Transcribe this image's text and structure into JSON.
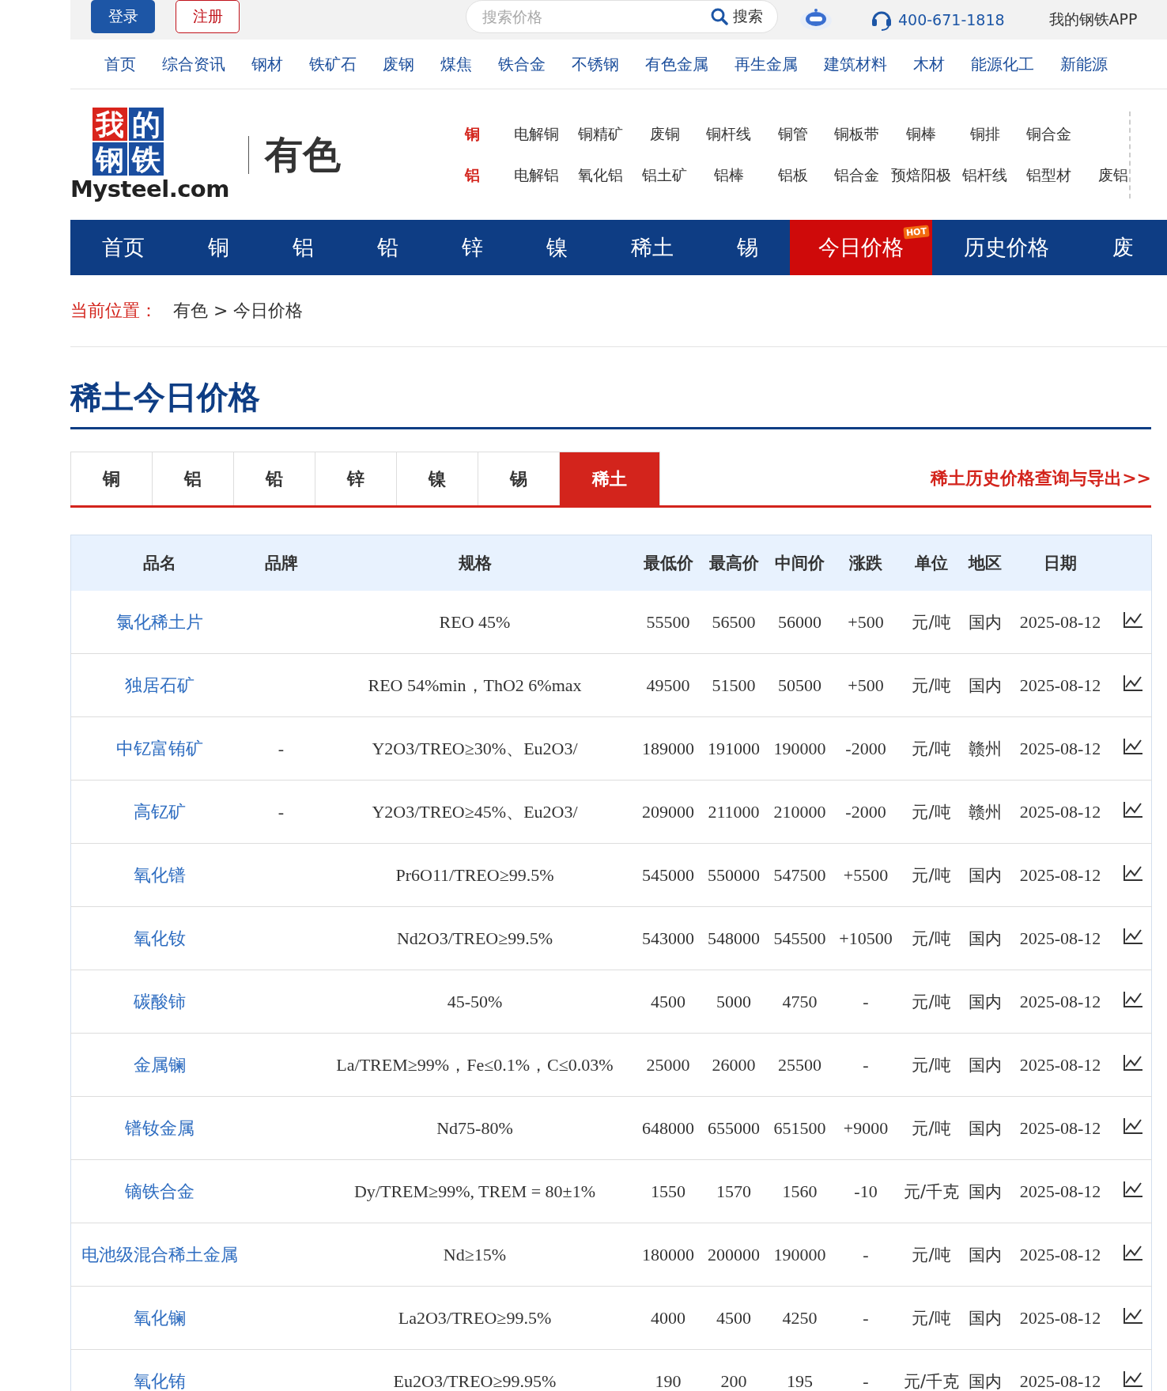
{
  "top_bar": {
    "login": "登录",
    "register": "注册",
    "search": {
      "placeholder": "搜索价格",
      "button": "搜索"
    },
    "phone": "400-671-1818",
    "app_link": "我的钢铁APP"
  },
  "main_nav": [
    "首页",
    "综合资讯",
    "钢材",
    "铁矿石",
    "废钢",
    "煤焦",
    "铁合金",
    "不锈钢",
    "有色金属",
    "再生金属",
    "建筑材料",
    "木材",
    "能源化工",
    "新能源"
  ],
  "logo": {
    "chars": "我的钢铁",
    "wordmark": "Mysteel.com"
  },
  "channel": "有色",
  "sub_links": [
    {
      "category": "铜",
      "items": [
        "电解铜",
        "铜精矿",
        "废铜",
        "铜杆线",
        "铜管",
        "铜板带",
        "铜棒",
        "铜排",
        "铜合金"
      ]
    },
    {
      "category": "铝",
      "items": [
        "电解铝",
        "氧化铝",
        "铝土矿",
        "铝棒",
        "铝板",
        "铝合金",
        "预焙阳极",
        "铝杆线",
        "铝型材",
        "废铝"
      ]
    }
  ],
  "section_nav": [
    {
      "label": "首页",
      "selected": false
    },
    {
      "label": "铜",
      "selected": false
    },
    {
      "label": "铝",
      "selected": false
    },
    {
      "label": "铅",
      "selected": false
    },
    {
      "label": "锌",
      "selected": false
    },
    {
      "label": "镍",
      "selected": false
    },
    {
      "label": "稀土",
      "selected": false
    },
    {
      "label": "锡",
      "selected": false
    },
    {
      "label": "今日价格",
      "selected": true,
      "badge": "HOT"
    },
    {
      "label": "历史价格",
      "selected": false
    },
    {
      "label": "废",
      "selected": false
    }
  ],
  "breadcrumb": {
    "label": "当前位置：",
    "path": "有色 > 今日价格"
  },
  "title": "稀土今日价格",
  "tabs": [
    {
      "label": "铜",
      "selected": false
    },
    {
      "label": "铝",
      "selected": false
    },
    {
      "label": "铅",
      "selected": false
    },
    {
      "label": "锌",
      "selected": false
    },
    {
      "label": "镍",
      "selected": false
    },
    {
      "label": "锡",
      "selected": false
    },
    {
      "label": "稀土",
      "selected": true
    }
  ],
  "history_link": "稀土历史价格查询与导出>>",
  "table": {
    "columns": [
      "品名",
      "品牌",
      "规格",
      "最低价",
      "最高价",
      "中间价",
      "涨跌",
      "单位",
      "地区",
      "日期"
    ],
    "rows": [
      {
        "name": "氯化稀土片",
        "spec": "REO 45%",
        "low": "55500",
        "high": "56500",
        "mid": "56000",
        "change": "+500",
        "unit": "元/吨",
        "region": "国内",
        "date": "2025-08-12"
      },
      {
        "name": "独居石矿",
        "spec": "REO 54%min，ThO2 6%max",
        "low": "49500",
        "high": "51500",
        "mid": "50500",
        "change": "+500",
        "unit": "元/吨",
        "region": "国内",
        "date": "2025-08-12"
      },
      {
        "name": "中钇富铕矿",
        "brand": "-",
        "spec": "Y2O3/TREO≥30%、Eu2O3/",
        "low": "189000",
        "high": "191000",
        "mid": "190000",
        "change": "-2000",
        "unit": "元/吨",
        "region": "赣州",
        "date": "2025-08-12"
      },
      {
        "name": "高钇矿",
        "brand": "-",
        "spec": "Y2O3/TREO≥45%、Eu2O3/",
        "low": "209000",
        "high": "211000",
        "mid": "210000",
        "change": "-2000",
        "unit": "元/吨",
        "region": "赣州",
        "date": "2025-08-12"
      },
      {
        "name": "氧化镨",
        "spec": "Pr6O11/TREO≥99.5%",
        "low": "545000",
        "high": "550000",
        "mid": "547500",
        "change": "+5500",
        "unit": "元/吨",
        "region": "国内",
        "date": "2025-08-12"
      },
      {
        "name": "氧化钕",
        "spec": "Nd2O3/TREO≥99.5%",
        "low": "543000",
        "high": "548000",
        "mid": "545500",
        "change": "+10500",
        "unit": "元/吨",
        "region": "国内",
        "date": "2025-08-12"
      },
      {
        "name": "碳酸铈",
        "spec": "45-50%",
        "low": "4500",
        "high": "5000",
        "mid": "4750",
        "change": "-",
        "unit": "元/吨",
        "region": "国内",
        "date": "2025-08-12"
      },
      {
        "name": "金属镧",
        "spec": "La/TREM≥99%，Fe≤0.1%，C≤0.03%",
        "low": "25000",
        "high": "26000",
        "mid": "25500",
        "change": "-",
        "unit": "元/吨",
        "region": "国内",
        "date": "2025-08-12"
      },
      {
        "name": "镨钕金属",
        "spec": "Nd75-80%",
        "low": "648000",
        "high": "655000",
        "mid": "651500",
        "change": "+9000",
        "unit": "元/吨",
        "region": "国内",
        "date": "2025-08-12"
      },
      {
        "name": "镝铁合金",
        "spec": "Dy/TREM≥99%, TREM = 80±1%",
        "low": "1550",
        "high": "1570",
        "mid": "1560",
        "change": "-10",
        "unit": "元/千克",
        "region": "国内",
        "date": "2025-08-12"
      },
      {
        "name": "电池级混合稀土金属",
        "spec": "Nd≥15%",
        "low": "180000",
        "high": "200000",
        "mid": "190000",
        "change": "-",
        "unit": "元/吨",
        "region": "国内",
        "date": "2025-08-12"
      },
      {
        "name": "氧化镧",
        "spec": "La2O3/TREO≥99.5%",
        "low": "4000",
        "high": "4500",
        "mid": "4250",
        "change": "-",
        "unit": "元/吨",
        "region": "国内",
        "date": "2025-08-12"
      },
      {
        "name": "氧化铕",
        "spec": "Eu2O3/TREO≥99.95%",
        "low": "190",
        "high": "200",
        "mid": "195",
        "change": "-",
        "unit": "元/千克",
        "region": "国内",
        "date": "2025-08-12"
      }
    ]
  }
}
